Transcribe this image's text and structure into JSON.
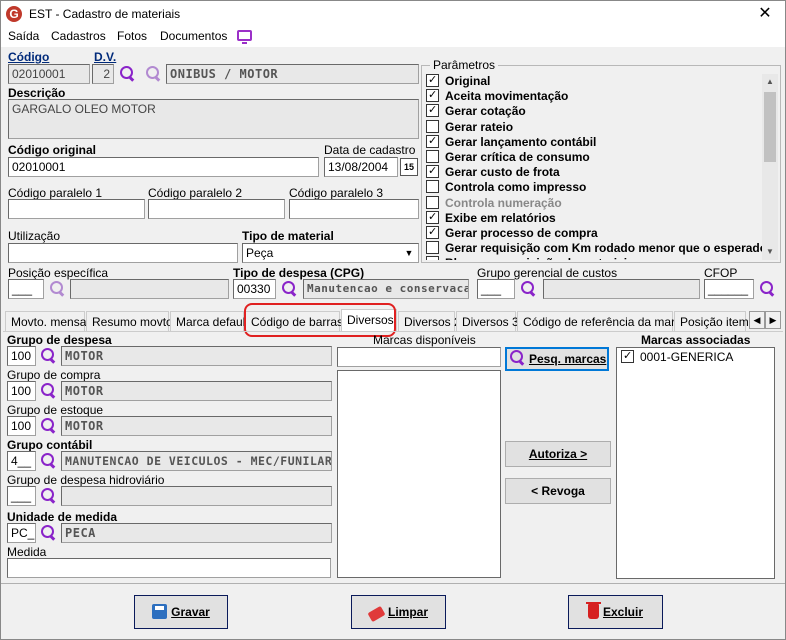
{
  "window": {
    "title": "EST - Cadastro de materiais",
    "logo_letter": "G",
    "close_glyph": "✕"
  },
  "menu": [
    "Saída",
    "Cadastros",
    "Fotos",
    "Documentos"
  ],
  "form": {
    "codigo_label": "Código",
    "codigo_value": "02010001",
    "dv_label": "D.V.",
    "dv_value": "2",
    "grupo_display": "ONIBUS / MOTOR",
    "descricao_label": "Descrição",
    "descricao_value": "GARGALO OLEO MOTOR",
    "codigo_original_label": "Código original",
    "codigo_original_value": "02010001",
    "data_cadastro_label": "Data de cadastro",
    "data_cadastro_value": "13/08/2004",
    "calendar_glyph": "15",
    "codigo_paralelo_1_label": "Código paralelo 1",
    "codigo_paralelo_2_label": "Código paralelo 2",
    "codigo_paralelo_3_label": "Código paralelo 3",
    "utilizacao_label": "Utilização",
    "tipo_material_label": "Tipo de material",
    "tipo_material_value": "Peça",
    "combo_glyph": "▼",
    "posicao_label": "Posição específica",
    "posicao_value": "___",
    "tipo_despesa_label": "Tipo de despesa (CPG)",
    "tipo_despesa_code": "00330",
    "tipo_despesa_desc": "Manutencao e conservacao",
    "grupo_gerencial_label": "Grupo gerencial de custos",
    "grupo_gerencial_value": "___",
    "cfop_label": "CFOP",
    "cfop_value": "______"
  },
  "params": {
    "title": "Parâmetros",
    "items": [
      {
        "label": "Original",
        "checked": true
      },
      {
        "label": "Aceita movimentação",
        "checked": true
      },
      {
        "label": "Gerar cotação",
        "checked": true
      },
      {
        "label": "Gerar rateio",
        "checked": false
      },
      {
        "label": "Gerar lançamento contábil",
        "checked": true
      },
      {
        "label": "Gerar crítica de consumo",
        "checked": false
      },
      {
        "label": "Gerar custo de frota",
        "checked": true
      },
      {
        "label": "Controla como impresso",
        "checked": false
      },
      {
        "label": "Controla numeração",
        "checked": false,
        "disabled": true
      },
      {
        "label": "Exibe em relatórios",
        "checked": true
      },
      {
        "label": "Gerar processo de compra",
        "checked": true
      },
      {
        "label": "Gerar requisição com Km rodado menor que o esperado",
        "checked": false
      },
      {
        "label": "Bloquear requisição de materiais",
        "checked": false
      }
    ],
    "scroll_up": "▲",
    "scroll_down": "▼"
  },
  "tabs": [
    "Movto. mensal",
    "Resumo movto.",
    "Marca default",
    "Código de barras",
    "Diversos",
    "Diversos 2",
    "Diversos 3",
    "Código de referência da marca",
    "Posição item"
  ],
  "tab_scroll": {
    "left": "◀",
    "right": "▶"
  },
  "diversos": {
    "grupo_despesa_label": "Grupo de despesa",
    "grupo_despesa_code": "100",
    "grupo_despesa_desc": "MOTOR",
    "grupo_compra_label": "Grupo de compra",
    "grupo_compra_code": "100",
    "grupo_compra_desc": "MOTOR",
    "grupo_estoque_label": "Grupo de estoque",
    "grupo_estoque_code": "100",
    "grupo_estoque_desc": "MOTOR",
    "grupo_contabil_label": "Grupo contábil",
    "grupo_contabil_code": "4__",
    "grupo_contabil_desc": "MANUTENCAO DE VEICULOS - MEC/FUNILAR",
    "grupo_hidroviario_label": "Grupo de despesa hidroviário",
    "grupo_hidroviario_code": "___",
    "unidade_label": "Unidade de medida",
    "unidade_code": "PC_",
    "unidade_desc": "PECA",
    "medida_label": "Medida"
  },
  "marcas": {
    "disponiveis_label": "Marcas disponíveis",
    "pesq_button": "Pesq. marcas",
    "autoriza_button": "Autoriza >",
    "revoga_button": "< Revoga",
    "associadas_label": "Marcas associadas",
    "associadas": [
      {
        "label": "0001-GENERICA",
        "checked": true
      }
    ]
  },
  "footer": {
    "gravar": "Gravar",
    "limpar": "Limpar",
    "excluir": "Excluir"
  }
}
